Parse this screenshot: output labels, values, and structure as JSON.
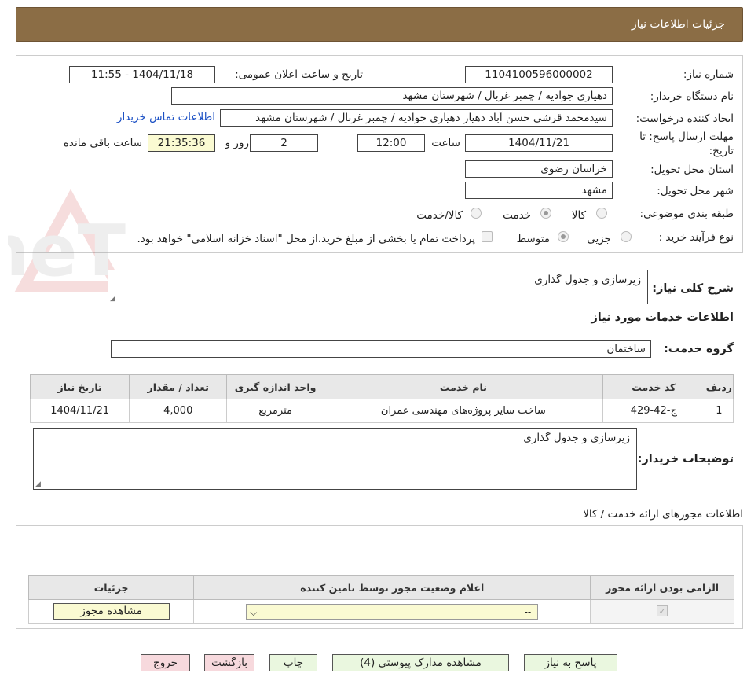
{
  "header": {
    "title": "جزئیات اطلاعات نیاز"
  },
  "form": {
    "need_number_label": "شماره نیاز:",
    "need_number": "1104100596000002",
    "announce_label": "تاریخ و ساعت اعلان عمومی:",
    "announce_value": "1404/11/18 - 11:55",
    "buyer_org_label": "نام دستگاه خریدار:",
    "buyer_org": "دهیاری جوادیه / چمبر غربال / شهرستان مشهد",
    "creator_label": "ایجاد کننده درخواست:",
    "creator": "سیدمحمد قرشی حسن آباد دهیار دهیاری جوادیه / چمبر غربال / شهرستان مشهد",
    "contact_link": "اطلاعات تماس خریدار",
    "deadline_label": "مهلت ارسال پاسخ: تا تاریخ:",
    "deadline_date": "1404/11/21",
    "time_label": "ساعت",
    "deadline_time": "12:00",
    "days": "2",
    "days_label": "روز و",
    "remaining_time": "21:35:36",
    "remaining_label": "ساعت باقی مانده",
    "province_label": "استان محل تحویل:",
    "province": "خراسان رضوی",
    "city_label": "شهر محل تحویل:",
    "city": "مشهد",
    "category_label": "طبقه بندی موضوعی:",
    "category_options": [
      "کالا",
      "خدمت",
      "کالا/خدمت"
    ],
    "process_label": "نوع فرآیند خرید :",
    "process_options": [
      "جزیی",
      "متوسط"
    ],
    "payment_note": "پرداخت تمام یا بخشی از مبلغ خرید،از محل \"اسناد خزانه اسلامی\" خواهد بود."
  },
  "description": {
    "label": "شرح کلی نیاز:",
    "value": "زیرسازی و جدول گذاری"
  },
  "services": {
    "section_title": "اطلاعات خدمات مورد نیاز",
    "group_label": "گروه خدمت:",
    "group_value": "ساختمان",
    "columns": [
      "ردیف",
      "کد خدمت",
      "نام خدمت",
      "واحد اندازه گیری",
      "تعداد / مقدار",
      "تاریخ نیاز"
    ],
    "rows": [
      [
        "1",
        "ج-42-429",
        "ساخت سایر پروژه‌های مهندسی عمران",
        "مترمربع",
        "4,000",
        "1404/11/21"
      ]
    ]
  },
  "buyer_notes": {
    "label": "توضیحات خریدار:",
    "value": "زیرسازی و جدول گذاری"
  },
  "permits": {
    "section_title": "اطلاعات مجوزهای ارائه خدمت / کالا",
    "columns": [
      "الزامی بودن ارائه مجوز",
      "اعلام وضعیت مجوز توسط تامین کننده",
      "جزئیات"
    ],
    "select_value": "--",
    "view_button": "مشاهده مجوز"
  },
  "buttons": {
    "reply": "پاسخ به نیاز",
    "attachments": "مشاهده مدارک پیوستی (4)",
    "print": "چاپ",
    "back": "بازگشت",
    "exit": "خروج"
  },
  "watermark": {
    "text": "AriaTender.neT"
  }
}
